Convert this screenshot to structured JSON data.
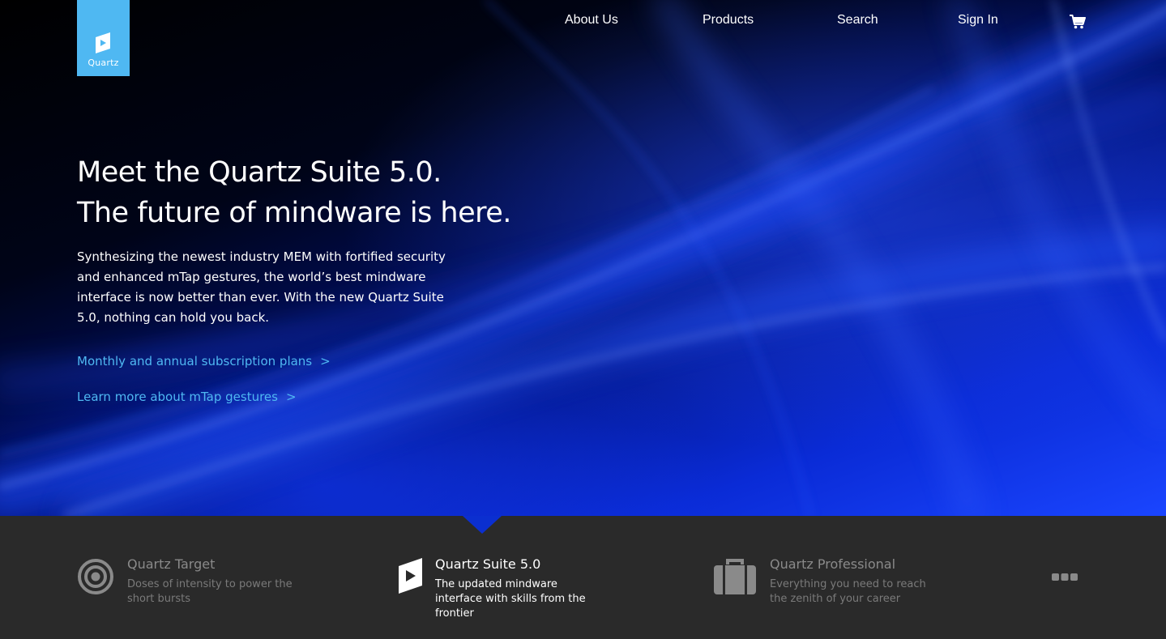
{
  "brand": {
    "logo_text": "Quartz",
    "accent": "#4fb8f2"
  },
  "nav": {
    "items": [
      {
        "label": "About Us"
      },
      {
        "label": "Products"
      },
      {
        "label": "Search"
      },
      {
        "label": "Sign In"
      }
    ],
    "cart_icon": "shopping-cart-icon"
  },
  "hero": {
    "headline_line1": "Meet the Quartz Suite 5.0.",
    "headline_line2": "The future of mindware is here.",
    "lede": "Synthesizing the newest industry MEM with fortified security and enhanced mTap gestures, the world’s best mindware interface is now better than ever. With the new Quartz Suite 5.0, nothing can hold you back.",
    "links": [
      {
        "label": "Monthly and annual subscription plans",
        "chevron": ">"
      },
      {
        "label": "Learn more about mTap gestures",
        "chevron": ">"
      }
    ]
  },
  "products": [
    {
      "title": "Quartz Target",
      "desc": "Doses of intensity to power the short bursts",
      "icon": "target-icon",
      "active": false
    },
    {
      "title": "Quartz Suite 5.0",
      "desc": "The updated mindware interface with skills from the frontier",
      "icon": "quartz-play-icon",
      "active": true
    },
    {
      "title": "Quartz Professional",
      "desc": "Everything you need to reach the zenith of your career",
      "icon": "briefcase-icon",
      "active": false
    }
  ],
  "more_icon": "more-dots-icon"
}
